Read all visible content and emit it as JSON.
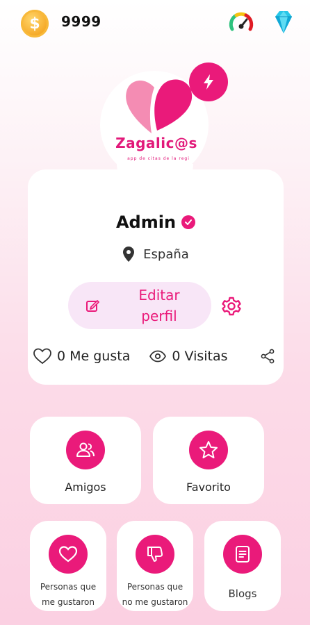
{
  "topbar": {
    "coin_symbol": "$",
    "coin_count": "9999",
    "speed_icon": "speedometer-icon",
    "diamond_icon": "diamond-icon"
  },
  "logo": {
    "app_name": "Zagalic@s",
    "tagline": "app de citas de la regi",
    "badge_icon": "lightning-icon"
  },
  "profile": {
    "name": "Admin",
    "location": "España",
    "edit_label": "Editar perfil",
    "likes": "0 Me gusta",
    "visits": "0 Visitas"
  },
  "tiles": {
    "friends": "Amigos",
    "favorite": "Favorito",
    "liked_line1": "Personas que",
    "liked_line2": "me gustaron",
    "disliked_line1": "Personas que",
    "disliked_line2": "no me gustaron",
    "blogs": "Blogs"
  },
  "colors": {
    "accent": "#ea1a7a",
    "edit_button_bg": "#f8e6f7"
  }
}
